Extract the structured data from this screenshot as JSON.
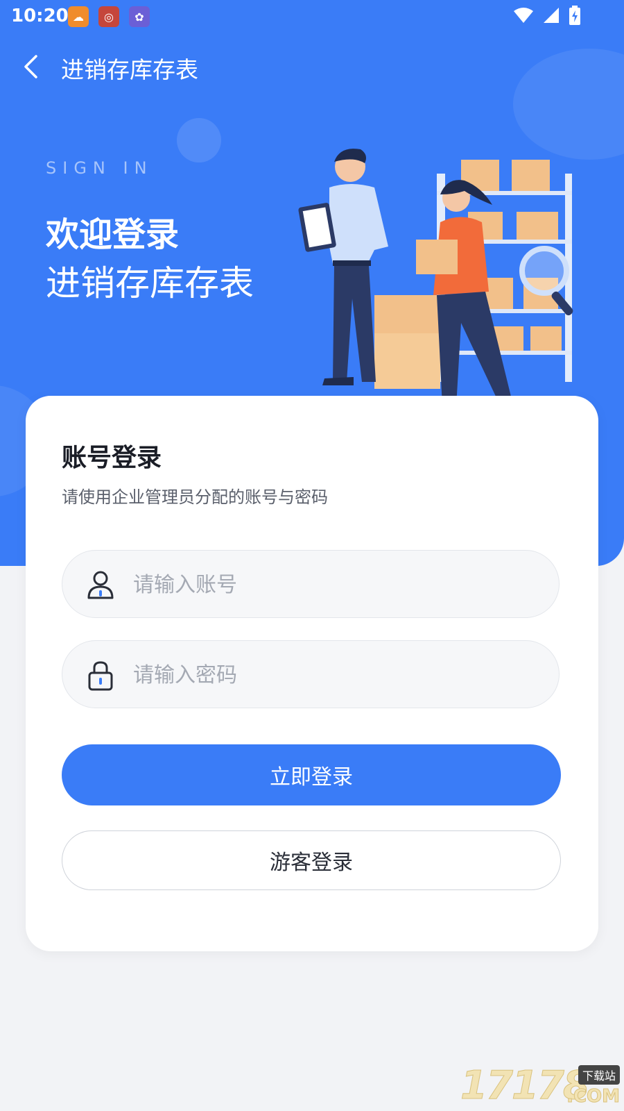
{
  "status_bar": {
    "time": "10:20",
    "apps": [
      "app-notification-1",
      "app-notification-2",
      "app-notification-3"
    ]
  },
  "nav": {
    "title": "进销存库存表"
  },
  "hero": {
    "sign_in": "SIGN IN",
    "welcome": "欢迎登录",
    "subtitle": "进销存库存表"
  },
  "login_card": {
    "title": "账号登录",
    "description": "请使用企业管理员分配的账号与密码",
    "account_placeholder": "请输入账号",
    "password_placeholder": "请输入密码",
    "login_button": "立即登录",
    "guest_button": "游客登录"
  },
  "watermark": {
    "number": "17178",
    "tag": "下载站",
    "com": ".COM"
  },
  "colors": {
    "primary": "#3a7cf7",
    "background": "#f2f3f6"
  }
}
